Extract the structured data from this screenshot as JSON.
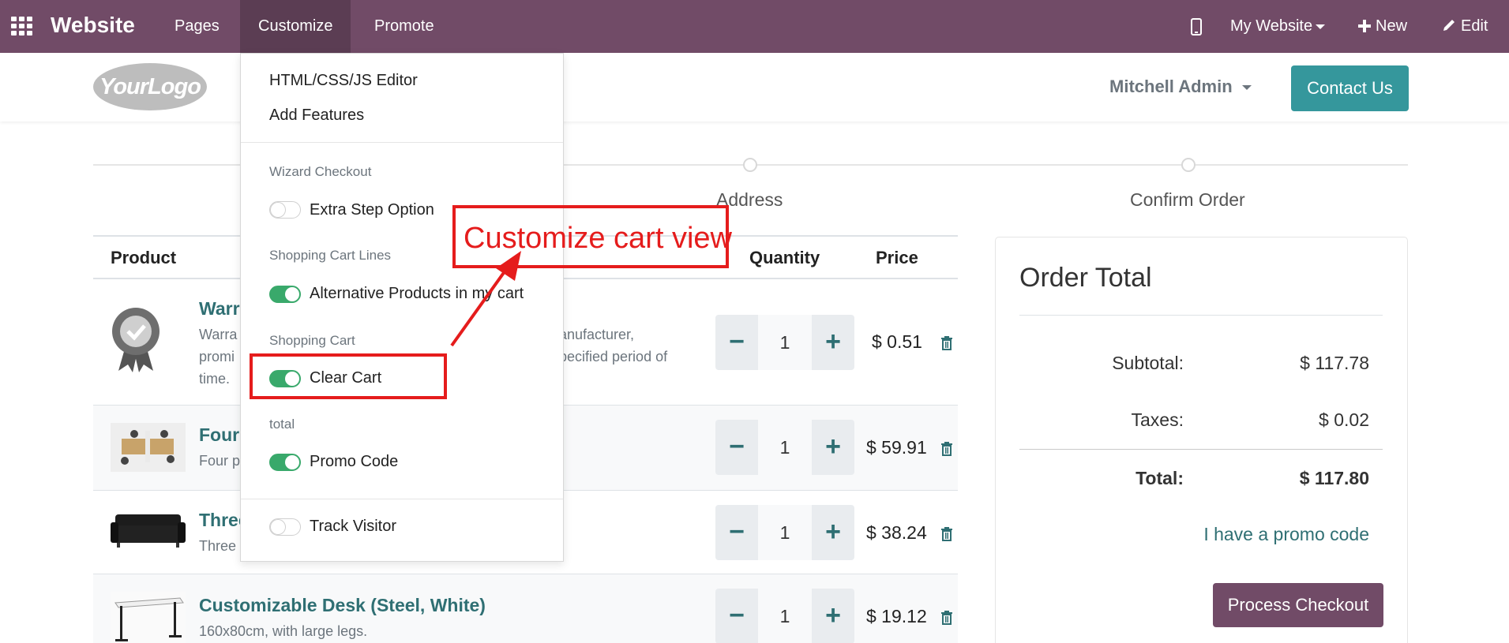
{
  "topbar": {
    "brand": "Website",
    "menu": [
      "Pages",
      "Customize",
      "Promote"
    ],
    "my_website": "My Website",
    "new_label": "New",
    "edit_label": "Edit"
  },
  "header": {
    "logo_text": "YourLogo",
    "user": "Mitchell Admin",
    "contact": "Contact Us"
  },
  "progress": {
    "steps": [
      "Address",
      "Confirm Order"
    ]
  },
  "cart": {
    "columns": {
      "product": "Product",
      "quantity": "Quantity",
      "price": "Price"
    },
    "rows": [
      {
        "name": "Warra",
        "desc_lines": [
          "Warra",
          "promi",
          "time."
        ],
        "desc_right_lines": [
          "anufacturer,",
          "pecified period of"
        ],
        "qty": "1",
        "price": "$ 0.51"
      },
      {
        "name": "Four",
        "desc_lines": [
          "Four p"
        ],
        "qty": "1",
        "price": "$ 59.91"
      },
      {
        "name": "Three",
        "desc_lines": [
          "Three"
        ],
        "qty": "1",
        "price": "$ 38.24"
      },
      {
        "name": "Customizable Desk (Steel, White)",
        "desc_lines": [
          "160x80cm, with large legs."
        ],
        "qty": "1",
        "price": "$ 19.12"
      }
    ]
  },
  "order_total": {
    "title": "Order Total",
    "subtotal_label": "Subtotal:",
    "subtotal": "$ 117.78",
    "taxes_label": "Taxes:",
    "taxes": "$ 0.02",
    "total_label": "Total:",
    "total": "$ 117.80",
    "promo_link": "I have a promo code",
    "checkout": "Process Checkout"
  },
  "dropdown": {
    "items": [
      "HTML/CSS/JS Editor",
      "Add Features"
    ],
    "wizard_header": "Wizard Checkout",
    "extra_step": "Extra Step Option",
    "cart_lines_header": "Shopping Cart Lines",
    "alt_products": "Alternative Products in my cart",
    "shopping_cart_header": "Shopping Cart",
    "clear_cart": "Clear Cart",
    "total_header": "total",
    "promo_code": "Promo Code",
    "track_visitor": "Track Visitor",
    "toggles": {
      "extra_step": false,
      "alt_products": true,
      "clear_cart": true,
      "promo_code": true,
      "track_visitor": false
    }
  },
  "annotation": {
    "text": "Customize cart view",
    "color": "#e51c1c"
  },
  "colors": {
    "topbar": "#714b67",
    "teal": "#35979c",
    "toggle_on": "#39a96b"
  }
}
